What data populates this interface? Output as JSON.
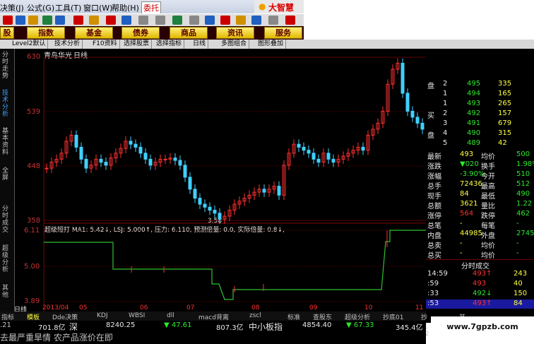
{
  "menu": {
    "items": [
      "决策(J)",
      "公式(G)",
      "工具(T)",
      "窗口(W)",
      "帮助(H)"
    ],
    "tag": "委托",
    "brand": "大智慧"
  },
  "nav": {
    "buttons": [
      "股",
      "指数",
      "基金",
      "债券",
      "商品",
      "资讯",
      "服务"
    ]
  },
  "tabs": [
    "Level2默认",
    "技术分析",
    "F10资料",
    "选择股票",
    "选择指标",
    "日线",
    "多图组合",
    "图形叠加"
  ],
  "vertical_tabs": [
    "分时走势",
    "技术分析",
    "基本资料",
    "全屏",
    "分时成交",
    "超级分析",
    "其他"
  ],
  "chart": {
    "stock_name": "青岛华光",
    "period": "日线",
    "price_axis": [
      "630",
      "539",
      "448",
      "358"
    ],
    "low_label": "3.58",
    "indicator_header": "超级短打 MA1: 5.42↓, LSJ: 5.000↑, 压力: 6.110, 预测倍量: 0.0, 实际倍量: 0.8↓,",
    "indicator_axis": [
      "6.11",
      "5.00",
      "3.89"
    ],
    "x_axis": [
      "2013/04",
      "05",
      "06",
      "07",
      "08",
      "09",
      "10",
      "11"
    ]
  },
  "chart_data": {
    "type": "candlestick",
    "title": "青岛华光 日线",
    "ylim": [
      3.58,
      6.3
    ],
    "series": [
      {
        "name": "price",
        "close": [
          4.45,
          4.55,
          4.6,
          4.7,
          4.9,
          5.0,
          4.8,
          4.6,
          4.45,
          4.5,
          4.6,
          4.55,
          4.5,
          4.62,
          4.7,
          4.78,
          4.9,
          4.85,
          4.8,
          4.7,
          4.6,
          4.5,
          4.55,
          4.6,
          4.6,
          4.62,
          4.58,
          4.5,
          4.3,
          4.1,
          3.95,
          3.85,
          3.8,
          3.75,
          3.7,
          3.6,
          3.65,
          3.75,
          3.85,
          3.9,
          3.95,
          4.0,
          4.05,
          4.1,
          4.05,
          4.1,
          4.15,
          4.0,
          4.5,
          4.7,
          4.85,
          4.8,
          4.75,
          4.7,
          4.6,
          4.55,
          4.7,
          4.6,
          4.55,
          4.6,
          4.65,
          4.7,
          4.75,
          4.8,
          4.75,
          5.0,
          5.1,
          5.2,
          5.4,
          5.85,
          6.1,
          6.2,
          5.7,
          5.4,
          5.3,
          5.2,
          5.1,
          5.0
        ]
      }
    ]
  },
  "quote": {
    "orderbook": [
      {
        "side": "盘",
        "level": "2",
        "price": "495",
        "vol": "335"
      },
      {
        "side": "",
        "level": "1",
        "price": "494",
        "vol": "165"
      },
      {
        "side": "",
        "level": "1",
        "price": "493",
        "vol": "265"
      },
      {
        "side": "买",
        "level": "2",
        "price": "492",
        "vol": "157"
      },
      {
        "side": "",
        "level": "3",
        "price": "491",
        "vol": "679"
      },
      {
        "side": "盘",
        "level": "4",
        "price": "490",
        "vol": "315"
      },
      {
        "side": "",
        "level": "5",
        "price": "489",
        "vol": "42"
      }
    ],
    "stats": [
      {
        "l": "最新",
        "v": "493",
        "l2": "均价",
        "v2": "500"
      },
      {
        "l": "涨跌",
        "v": "▼020",
        "l2": "换手",
        "v2": "1.98%"
      },
      {
        "l": "涨幅",
        "v": "-3.90%",
        "l2": "今开",
        "v2": "510"
      },
      {
        "l": "总手",
        "v": "72436",
        "l2": "最高",
        "v2": "512"
      },
      {
        "l": "现手",
        "v": "84",
        "l2": "最低",
        "v2": "490"
      },
      {
        "l": "总额",
        "v": "3621",
        "l2": "量比",
        "v2": "1.22"
      },
      {
        "l": "涨停",
        "v": "564",
        "l2": "跌停",
        "v2": "462"
      },
      {
        "l": "总笔",
        "v": "-",
        "l2": "每笔",
        "v2": "-"
      },
      {
        "l": "内盘",
        "v": "44985",
        "l2": "外盘",
        "v2": "27451"
      },
      {
        "l": "总卖",
        "v": "-",
        "l2": "均价",
        "v2": "-"
      },
      {
        "l": "总买",
        "v": "-",
        "l2": "均价",
        "v2": "-"
      }
    ],
    "ticks_header": "分时成交",
    "ticks": [
      {
        "t": "14:59",
        "p": "493↑",
        "v": "243"
      },
      {
        "t": ":59",
        "p": "493",
        "v": "40"
      },
      {
        "t": ":33",
        "p": "492↓",
        "v": "150"
      },
      {
        "t": ":53",
        "p": "493↑",
        "v": "84"
      }
    ]
  },
  "bottom_tabs": [
    "指标",
    "模板",
    "Dde决策",
    "KDJ",
    "WBSI",
    "dll",
    "macd背离",
    "zscl",
    "标准",
    "查股东",
    "超级分析",
    "抄底01",
    "抄底02",
    "其他"
  ],
  "status": {
    "row1": [
      ".21",
      "701.8亿",
      "深",
      "8240.25",
      "▼ 47.61",
      "807.3亿",
      "中小板指",
      "4854.40",
      "▼ 67.33",
      "345.4亿"
    ],
    "row2": "去最严重旱情 农产品涨价在即"
  },
  "watermark": "www.7gpzb.com"
}
